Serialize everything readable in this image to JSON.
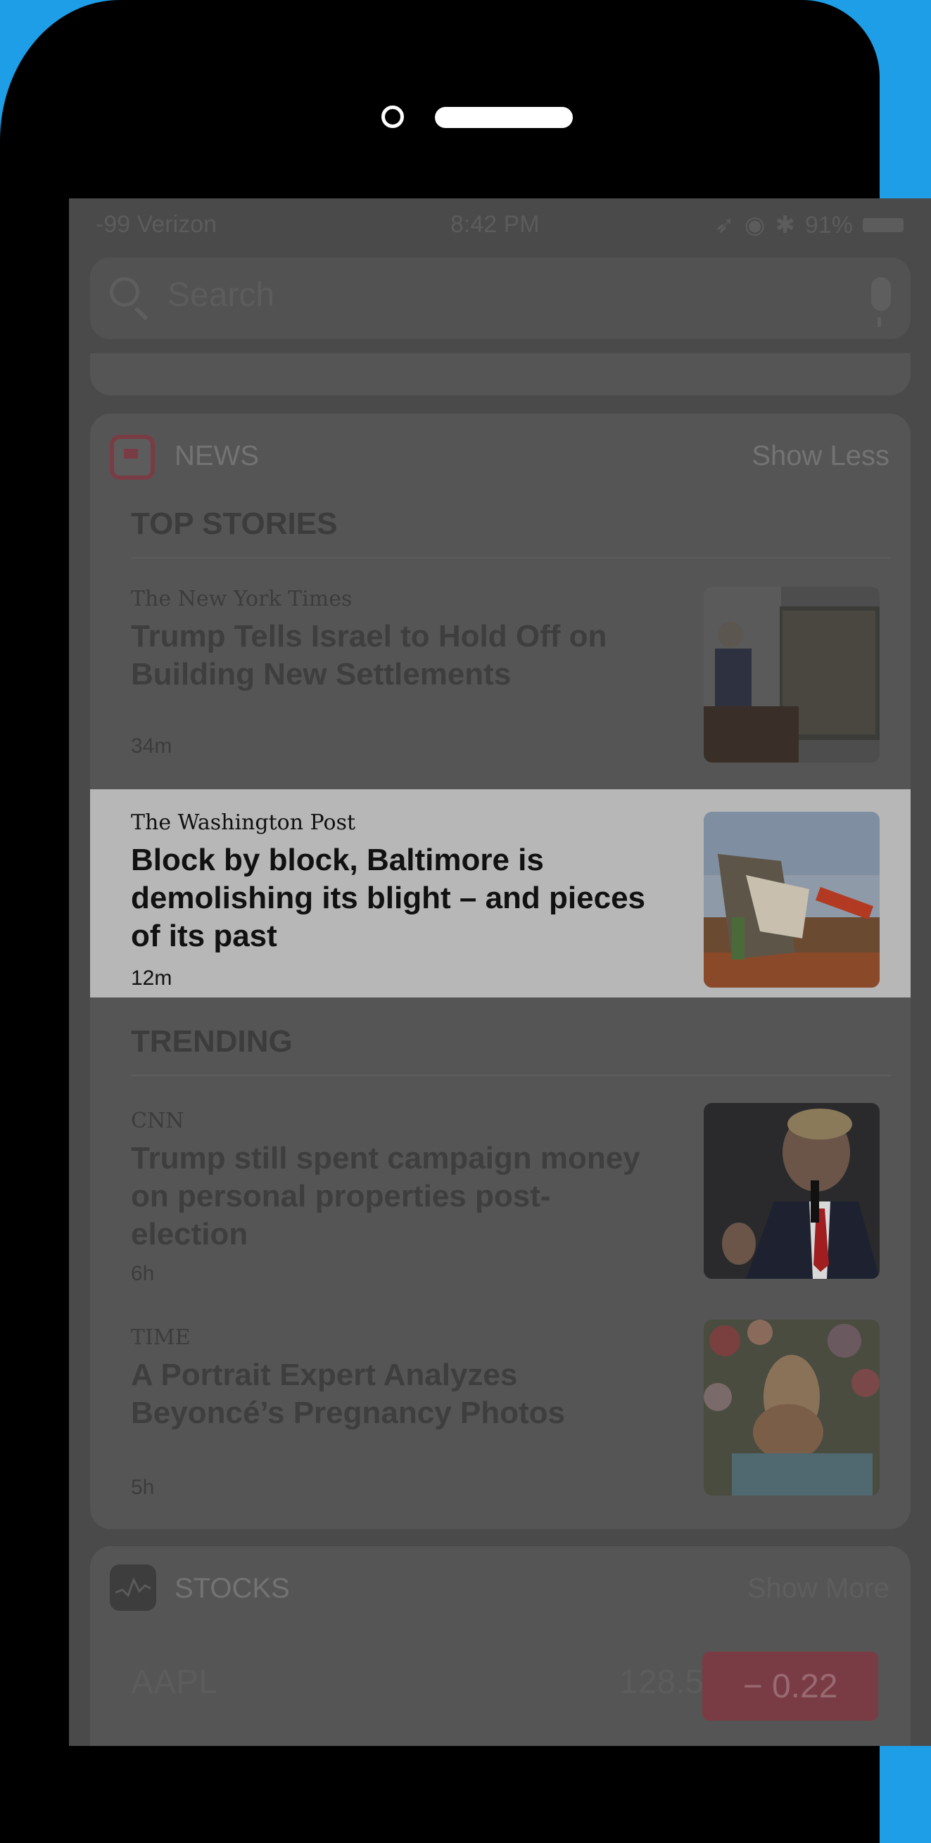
{
  "statusbar": {
    "carrier": "-99 Verizon",
    "time": "8:42 PM",
    "battery": "91%"
  },
  "search": {
    "placeholder": "Search"
  },
  "news": {
    "title": "NEWS",
    "toggle": "Show Less",
    "sections": [
      {
        "title": "TOP STORIES"
      },
      {
        "title": "TRENDING"
      }
    ],
    "stories": [
      {
        "source": "The New York Times",
        "headline": "Trump Tells Israel to Hold Off on Building New Settlements",
        "age": "34m"
      },
      {
        "source": "The Washington Post",
        "headline": "Block by block, Baltimore is demolishing its blight – and pieces of its past",
        "age": "12m"
      },
      {
        "source": "CNN",
        "headline": "Trump still spent campaign money on personal properties post-election",
        "age": "6h"
      },
      {
        "source": "TIME",
        "headline": "A Portrait Expert Analyzes Beyoncé’s Pregnancy Photos",
        "age": "5h"
      }
    ]
  },
  "stocks": {
    "title": "STOCKS",
    "toggle": "Show More",
    "items": [
      {
        "symbol": "AAPL",
        "price": "128.53",
        "change": "− 0.22"
      }
    ]
  }
}
